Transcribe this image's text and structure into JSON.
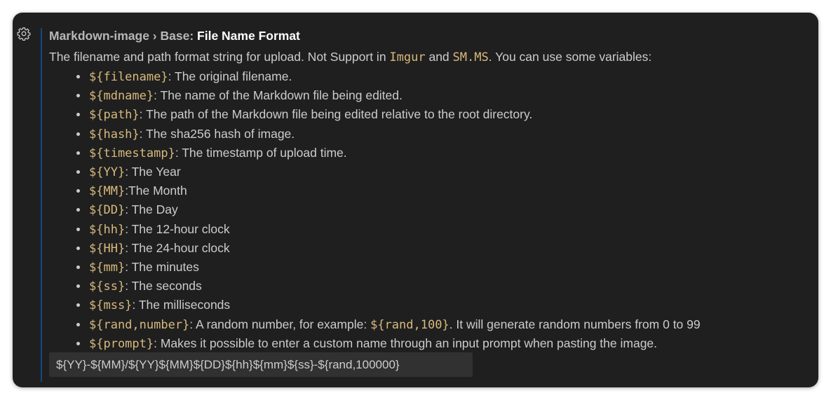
{
  "setting": {
    "category": "Markdown-image › Base:",
    "name": "File Name Format",
    "description": {
      "prefix": "The filename and path format string for upload. Not Support in ",
      "code1": "Imgur",
      "middle": " and ",
      "code2": "SM.MS",
      "suffix": ". You can use some variables:"
    },
    "variables": [
      {
        "code": "${filename}",
        "text": ": The original filename."
      },
      {
        "code": "${mdname}",
        "text": ": The name of the Markdown file being edited."
      },
      {
        "code": "${path}",
        "text": ": The path of the Markdown file being edited relative to the root directory."
      },
      {
        "code": "${hash}",
        "text": ": The sha256 hash of image."
      },
      {
        "code": "${timestamp}",
        "text": ": The timestamp of upload time."
      },
      {
        "code": "${YY}",
        "text": ": The Year"
      },
      {
        "code": "${MM}",
        "text": ":The Month"
      },
      {
        "code": "${DD}",
        "text": ": The Day"
      },
      {
        "code": "${hh}",
        "text": ": The 12-hour clock"
      },
      {
        "code": "${HH}",
        "text": ": The 24-hour clock"
      },
      {
        "code": "${mm}",
        "text": ": The minutes"
      },
      {
        "code": "${ss}",
        "text": ": The seconds"
      },
      {
        "code": "${mss}",
        "text": ": The milliseconds"
      },
      {
        "code": "${rand,number}",
        "text": ": A random number, for example: ",
        "code2": "${rand,100}",
        "text2": ". It will generate random numbers from 0 to 99"
      },
      {
        "code": "${prompt}",
        "text": ": Makes it possible to enter a custom name through an input prompt when pasting the image."
      }
    ],
    "value": "${YY}-${MM}/${YY}${MM}${DD}${hh}${mm}${ss}-${rand,100000}"
  },
  "icons": {
    "gear": "gear-icon"
  },
  "colors": {
    "background": "#1f1f1f",
    "text": "#cccccc",
    "code": "#d7ba7d",
    "focus_bar": "#0f4a85",
    "input_background": "#313131"
  }
}
